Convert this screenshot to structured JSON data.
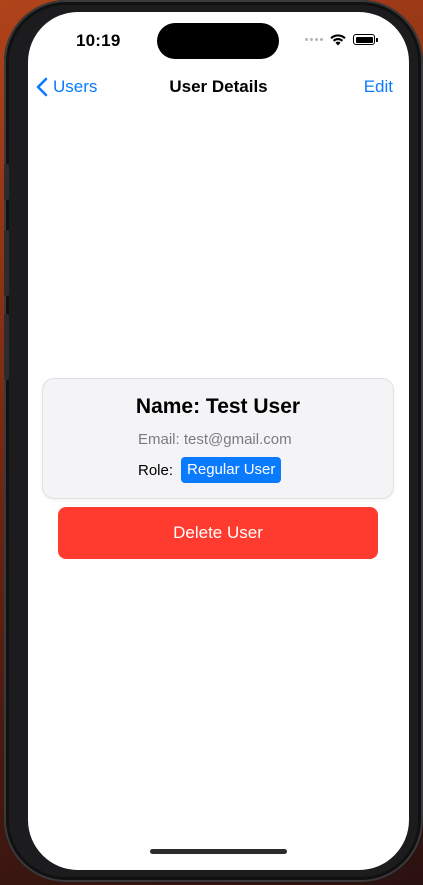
{
  "status_bar": {
    "time": "10:19",
    "icons": [
      "cellular-dots-icon",
      "wifi-icon",
      "battery-icon"
    ]
  },
  "nav": {
    "back_label": "Users",
    "back_icon": "chevron-left-icon",
    "title": "User Details",
    "edit_label": "Edit"
  },
  "user_card": {
    "name": "Name: Test User",
    "email": "Email: test@gmail.com",
    "role_label": "Role:",
    "role_value": "Regular User"
  },
  "actions": {
    "delete_label": "Delete User"
  },
  "colors": {
    "accent": "#0a7aff",
    "destructive": "#ff3b30",
    "card_background": "#f4f3f6",
    "secondary_text": "#7c7c80"
  }
}
